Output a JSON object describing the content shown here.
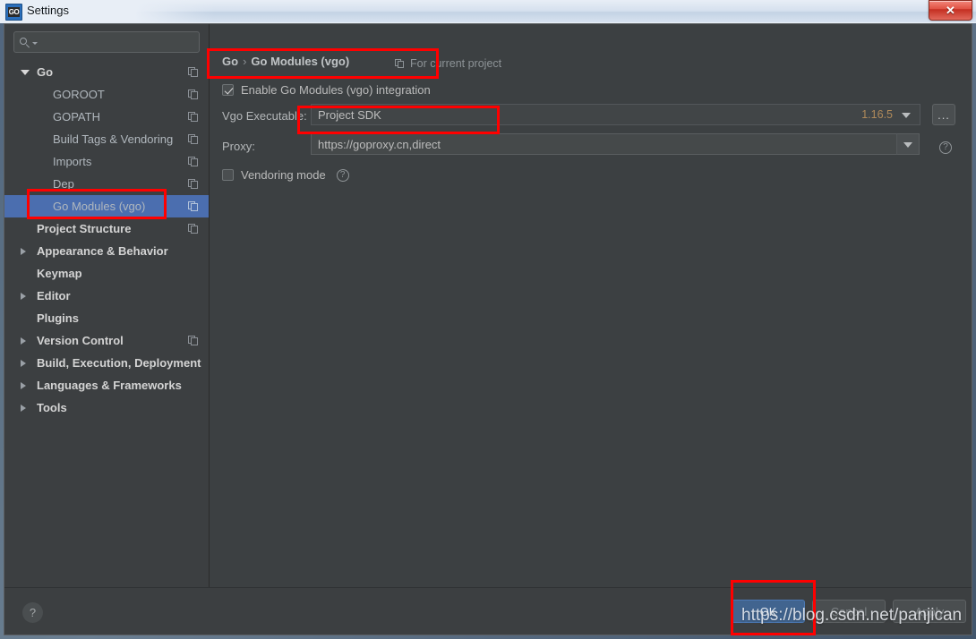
{
  "window": {
    "title": "Settings",
    "app_icon": "go-logo-icon",
    "close_label": "✕"
  },
  "sidebar": {
    "search": {
      "value": "",
      "placeholder": "",
      "icon": "search-icon"
    },
    "items": [
      {
        "label": "Go",
        "level": 0,
        "arrow": "down",
        "scope_icon": true,
        "selected": false
      },
      {
        "label": "GOROOT",
        "level": 1,
        "arrow": "none",
        "scope_icon": true,
        "selected": false
      },
      {
        "label": "GOPATH",
        "level": 1,
        "arrow": "none",
        "scope_icon": true,
        "selected": false
      },
      {
        "label": "Build Tags & Vendoring",
        "level": 1,
        "arrow": "none",
        "scope_icon": true,
        "selected": false
      },
      {
        "label": "Imports",
        "level": 1,
        "arrow": "none",
        "scope_icon": true,
        "selected": false
      },
      {
        "label": "Dep",
        "level": 1,
        "arrow": "none",
        "scope_icon": true,
        "selected": false
      },
      {
        "label": "Go Modules (vgo)",
        "level": 1,
        "arrow": "none",
        "scope_icon": true,
        "selected": true
      },
      {
        "label": "Project Structure",
        "level": 0,
        "arrow": "none",
        "scope_icon": true,
        "selected": false
      },
      {
        "label": "Appearance & Behavior",
        "level": 0,
        "arrow": "right",
        "scope_icon": false,
        "selected": false
      },
      {
        "label": "Keymap",
        "level": 0,
        "arrow": "none",
        "scope_icon": false,
        "selected": false
      },
      {
        "label": "Editor",
        "level": 0,
        "arrow": "right",
        "scope_icon": false,
        "selected": false
      },
      {
        "label": "Plugins",
        "level": 0,
        "arrow": "none",
        "scope_icon": false,
        "selected": false
      },
      {
        "label": "Version Control",
        "level": 0,
        "arrow": "right",
        "scope_icon": true,
        "selected": false
      },
      {
        "label": "Build, Execution, Deployment",
        "level": 0,
        "arrow": "right",
        "scope_icon": false,
        "selected": false
      },
      {
        "label": "Languages & Frameworks",
        "level": 0,
        "arrow": "right",
        "scope_icon": false,
        "selected": false
      },
      {
        "label": "Tools",
        "level": 0,
        "arrow": "right",
        "scope_icon": false,
        "selected": false
      }
    ]
  },
  "main": {
    "breadcrumb": {
      "root": "Go",
      "separator": "›",
      "current": "Go Modules (vgo)"
    },
    "scope_note": {
      "label": "For current project",
      "icon": "copy-scope-icon"
    },
    "enable_modules": {
      "label": "Enable Go Modules (vgo) integration",
      "checked": true
    },
    "vgo_executable": {
      "label": "Vgo Executable:",
      "value": "Project SDK",
      "version": "1.16.5",
      "browse_label": "...",
      "dropdown_icon": "chevron-down-icon"
    },
    "proxy": {
      "label": "Proxy:",
      "value": "https://goproxy.cn,direct",
      "dropdown_icon": "chevron-down-icon",
      "help_icon": "help-circle-icon",
      "help_glyph": "?"
    },
    "vendoring": {
      "label": "Vendoring mode",
      "checked": false,
      "help_glyph": "?"
    }
  },
  "footer": {
    "help_glyph": "?",
    "ok_label": "OK",
    "cancel_label": "Cancel",
    "apply_label": "Apply"
  },
  "watermark": {
    "text": "https://blog.csdn.net/panjican"
  },
  "colors": {
    "selection_blue": "#4b6eaf",
    "annotation_red": "#ff0000",
    "primary_button": "#41648f",
    "version_text": "#b08a5a"
  }
}
